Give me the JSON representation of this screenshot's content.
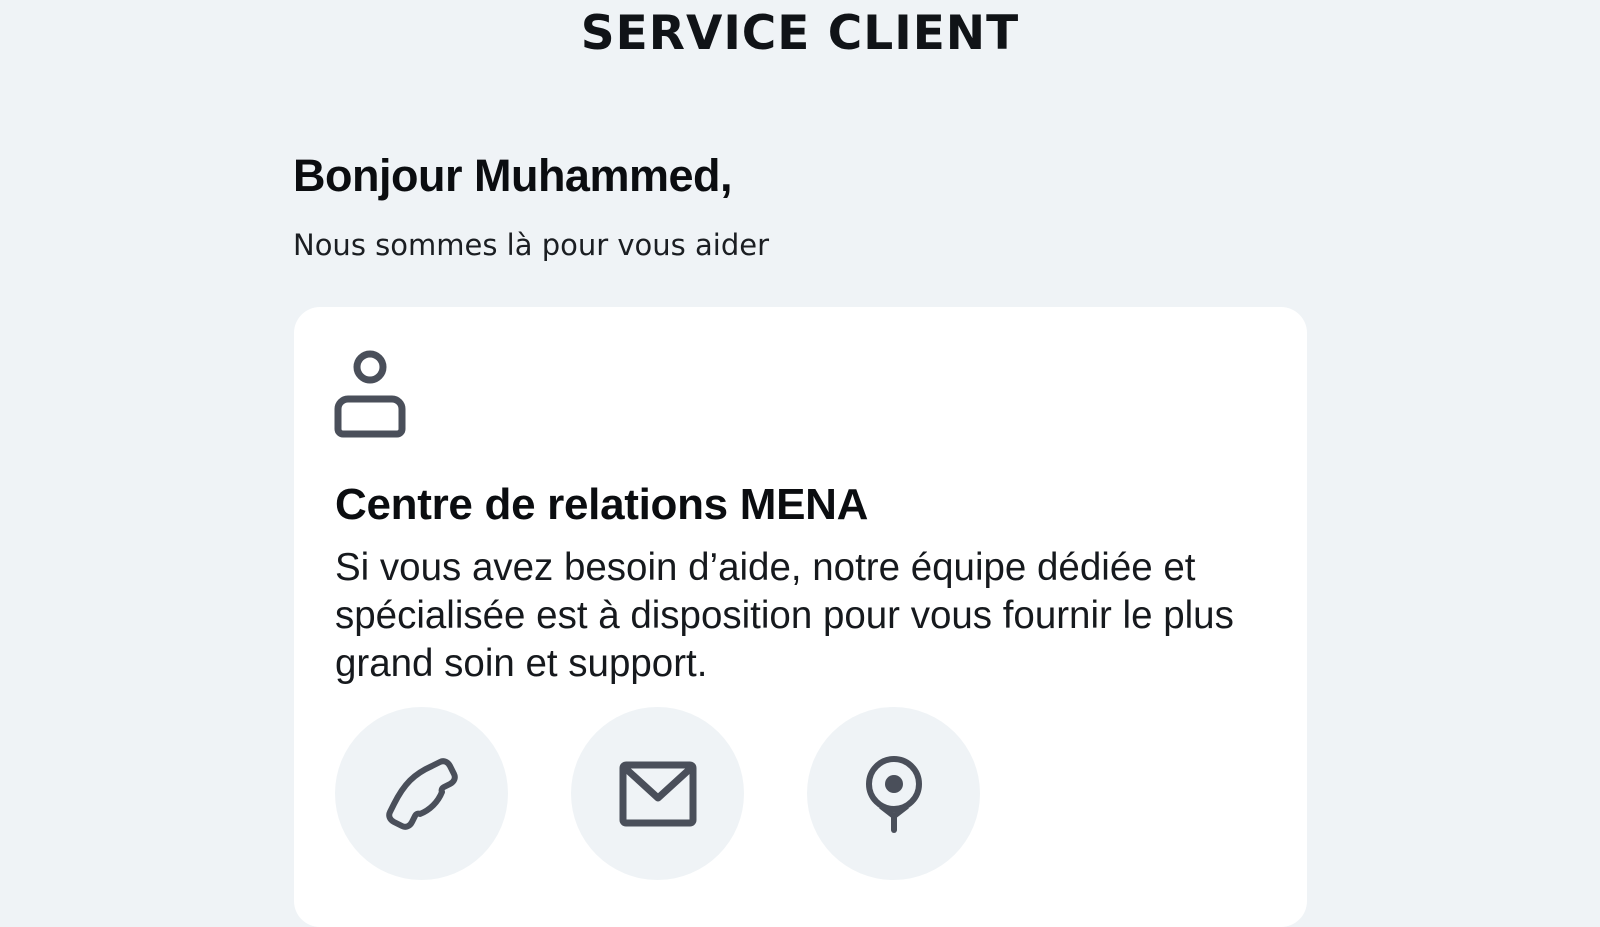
{
  "header": {
    "title": "SERVICE CLIENT"
  },
  "greeting": {
    "title": "Bonjour Muhammed,",
    "subtitle": "Nous sommes là pour vous aider"
  },
  "card": {
    "icon": "user-icon",
    "title": "Centre de relations MENA",
    "description": "Si vous avez besoin d’aide, notre équipe dédiée et spécialisée est à disposition pour vous fournir le plus grand soin et support.",
    "actions": [
      {
        "icon": "phone-icon"
      },
      {
        "icon": "mail-icon"
      },
      {
        "icon": "location-pin-icon"
      }
    ]
  },
  "colors": {
    "background": "#eff3f6",
    "card": "#ffffff",
    "icon": "#4a4f5a",
    "text": "#0b0d10"
  }
}
